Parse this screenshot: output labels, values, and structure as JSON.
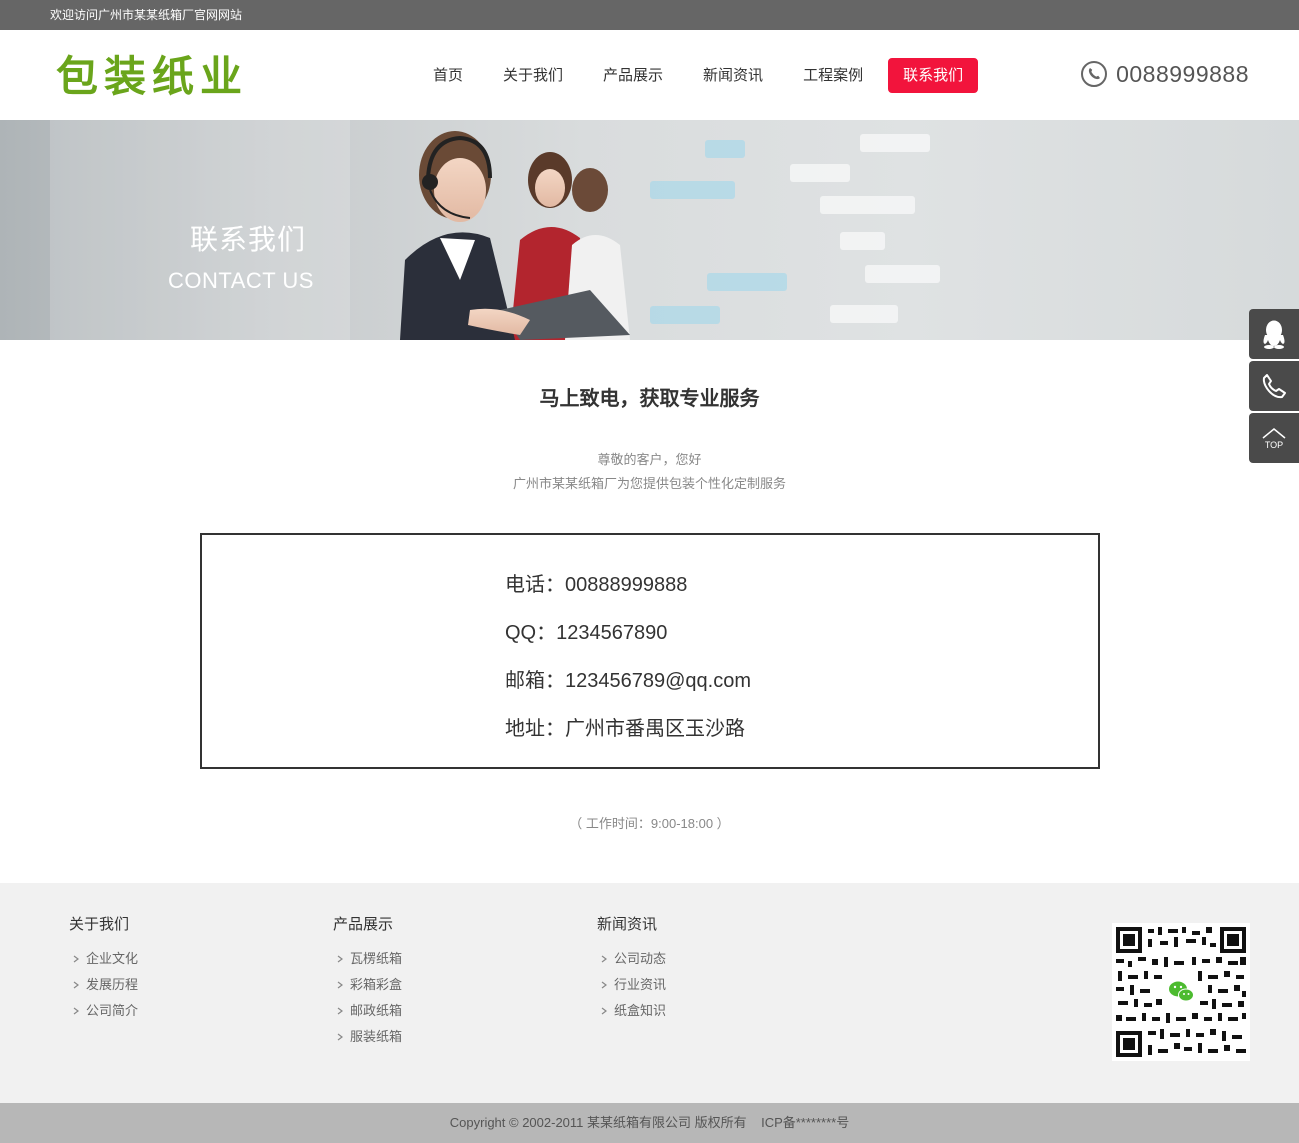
{
  "topbar": {
    "welcome": "欢迎访问广州市某某纸箱厂官网网站"
  },
  "header": {
    "logo_text": "包装纸业",
    "nav": [
      "首页",
      "关于我们",
      "产品展示",
      "新闻资讯",
      "工程案例",
      "联系我们"
    ],
    "active_nav": "联系我们",
    "phone": "0088999888",
    "phone_icon": "phone-circle-icon"
  },
  "banner": {
    "title": "联系我们",
    "subtitle": "CONTACT US"
  },
  "main": {
    "heading": "马上致电，获取专业服务",
    "greeting": "尊敬的客户，您好",
    "intro": "广州市某某纸箱厂为您提供包装个性化定制服务",
    "contacts": [
      "电话：00888999888",
      "QQ：1234567890",
      "邮箱：123456789@qq.com",
      "地址：广州市番禺区玉沙路"
    ],
    "hours": "（ 工作时间：9:00-18:00 ）"
  },
  "footer": {
    "columns": [
      {
        "title": "关于我们",
        "links": [
          "企业文化",
          "发展历程",
          "公司简介"
        ]
      },
      {
        "title": "产品展示",
        "links": [
          "瓦楞纸箱",
          "彩箱彩盒",
          "邮政纸箱",
          "服装纸箱"
        ]
      },
      {
        "title": "新闻资讯",
        "links": [
          "公司动态",
          "行业资讯",
          "纸盒知识"
        ]
      }
    ],
    "qr_icon": "wechat-icon",
    "copyright": "Copyright © 2002-2011 某某纸箱有限公司 版权所有    ICP备********号"
  },
  "side": {
    "buttons": [
      "qq-icon",
      "phone-icon",
      "top-icon"
    ],
    "top_label": "TOP"
  },
  "colors": {
    "accent": "#f2143c",
    "logo": "#6aa51b",
    "topbar": "#666666",
    "footer": "#f1f1f1"
  }
}
